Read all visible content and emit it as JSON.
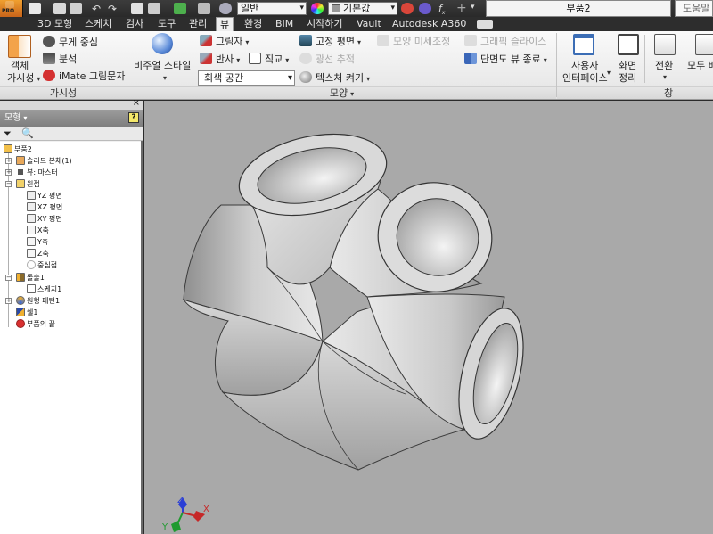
{
  "window": {
    "document_title": "부품2",
    "help_search": "도움말",
    "app_badge": "PRO"
  },
  "quick_access": {
    "material_value": "일반",
    "appearance_value": "기본값"
  },
  "tabs": [
    {
      "label": "3D 모형",
      "active": false
    },
    {
      "label": "스케치",
      "active": false
    },
    {
      "label": "검사",
      "active": false
    },
    {
      "label": "도구",
      "active": false
    },
    {
      "label": "관리",
      "active": false
    },
    {
      "label": "뷰",
      "active": true
    },
    {
      "label": "환경",
      "active": false
    },
    {
      "label": "BIM",
      "active": false
    },
    {
      "label": "시작하기",
      "active": false
    },
    {
      "label": "Vault",
      "active": false
    },
    {
      "label": "Autodesk A360",
      "active": false
    }
  ],
  "ribbon": {
    "visibility_panel": {
      "title": "가시성",
      "object_visibility_line1": "객체",
      "object_visibility_line2": "가시성",
      "center_of_gravity": "무게 중심",
      "analysis": "분석",
      "imate_glyph": "iMate 그림문자"
    },
    "appearance_panel": {
      "title": "모양",
      "visual_style": "비주얼 스타일",
      "shadows": "그림자",
      "reflections": "반사",
      "orthographic": "직교",
      "ground_plane": "고정 평면",
      "ray_tracing": "광선 추적",
      "texture_on": "텍스처 켜기",
      "appearance_adjust": "모양 미세조정",
      "graphics_slider": "그래픽 슬라이스",
      "section_view_end": "단면도 뷰 종료",
      "background_value": "회색 공간"
    },
    "window_panel": {
      "title": "창",
      "user_interface_line1": "사용자",
      "user_interface_line2": "인터페이스",
      "clean_screen_line1": "화면",
      "clean_screen_line2": "정리",
      "switch": "전환",
      "arrange_all": "모두 배"
    }
  },
  "browser": {
    "header": "모형",
    "items": [
      {
        "label": "부품2",
        "icon": "part-icon"
      },
      {
        "label": "솔리드 본체(1)",
        "icon": "solid-bodies-icon"
      },
      {
        "label": "뷰: 마스터",
        "icon": "view-rep-icon"
      },
      {
        "label": "원점",
        "icon": "origin-folder-icon"
      },
      {
        "label": "YZ 평면",
        "icon": "plane-icon"
      },
      {
        "label": "XZ 평면",
        "icon": "plane-icon"
      },
      {
        "label": "XY 평면",
        "icon": "plane-icon"
      },
      {
        "label": "X축",
        "icon": "axis-icon"
      },
      {
        "label": "Y축",
        "icon": "axis-icon"
      },
      {
        "label": "Z축",
        "icon": "axis-icon"
      },
      {
        "label": "중심점",
        "icon": "center-point-icon"
      },
      {
        "label": "돌출1",
        "icon": "extrude-icon"
      },
      {
        "label": "스케치1",
        "icon": "sketch-icon"
      },
      {
        "label": "원형 패턴1",
        "icon": "circular-pattern-icon"
      },
      {
        "label": "쉘1",
        "icon": "shell-icon"
      },
      {
        "label": "부품의 끝",
        "icon": "end-of-part-icon"
      }
    ]
  },
  "triad": {
    "x_label": "X",
    "y_label": "Y",
    "z_label": "Z"
  },
  "colors": {
    "viewport_bg": "#a9a9a9",
    "model_fill": "#d4d4d4",
    "accent_orange": "#e8892b",
    "active_tab": "#eeeeee"
  }
}
